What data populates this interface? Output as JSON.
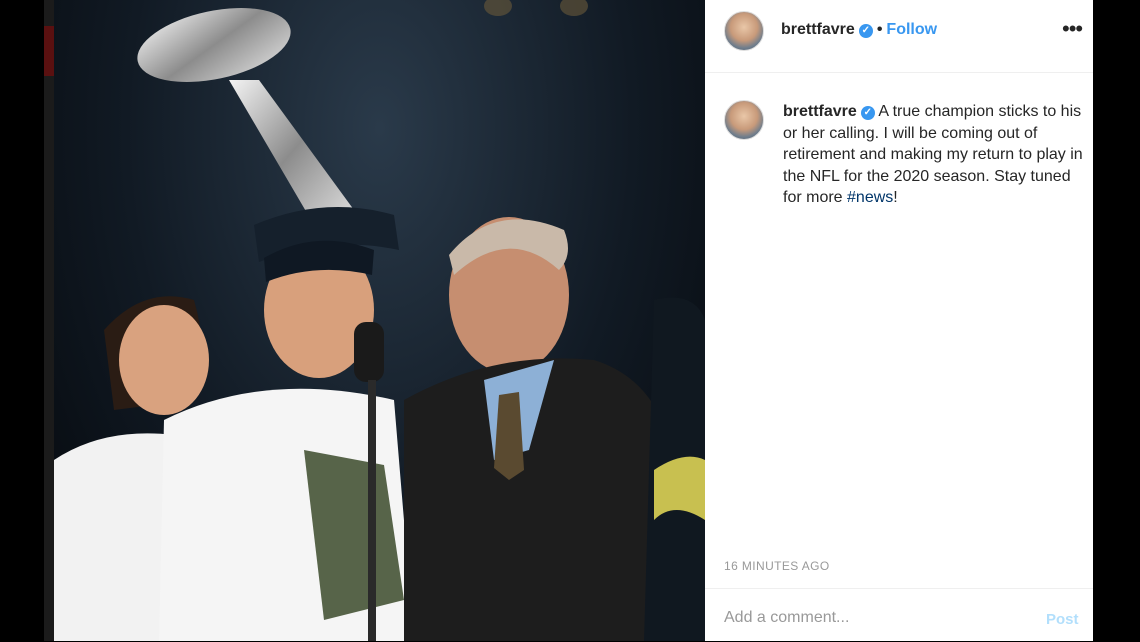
{
  "post": {
    "username": "brettfavre",
    "verified_icon": "verified-check-icon",
    "separator": "•",
    "follow_label": "Follow",
    "more_icon": "more-options-icon",
    "more_glyph": "•••",
    "caption_before": " A true champion sticks to his or her calling. I will be coming out of retirement and making my return to play in the NFL for the 2020 season. Stay tuned for more ",
    "hashtag": "#news",
    "caption_after": "!",
    "timestamp": "16 MINUTES AGO",
    "comment_placeholder": "Add a comment...",
    "post_label": "Post"
  },
  "colors": {
    "accent": "#3897f0",
    "hashtag": "#003569",
    "post_disabled": "#b2dffc"
  }
}
